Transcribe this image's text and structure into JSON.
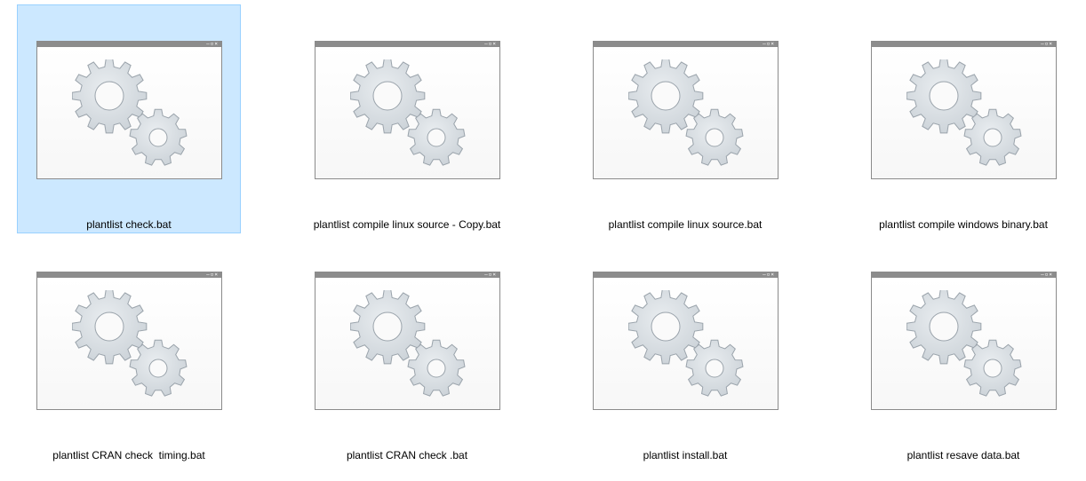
{
  "window": {
    "title": ""
  },
  "icon_name": "gears-icon",
  "colors": {
    "selection_bg": "#cce8ff",
    "selection_border": "#99d1ff",
    "window_frame": "#8c8c8c",
    "gear_fill": "#c9d0d6"
  },
  "files": [
    {
      "name": "plantlist check.bat",
      "selected": true
    },
    {
      "name": "plantlist compile linux source - Copy.bat",
      "selected": false
    },
    {
      "name": "plantlist compile linux source.bat",
      "selected": false
    },
    {
      "name": "plantlist compile windows binary.bat",
      "selected": false
    },
    {
      "name": "plantlist CRAN check  timing.bat",
      "selected": false
    },
    {
      "name": "plantlist CRAN check .bat",
      "selected": false
    },
    {
      "name": "plantlist install.bat",
      "selected": false
    },
    {
      "name": "plantlist resave data.bat",
      "selected": false
    }
  ]
}
